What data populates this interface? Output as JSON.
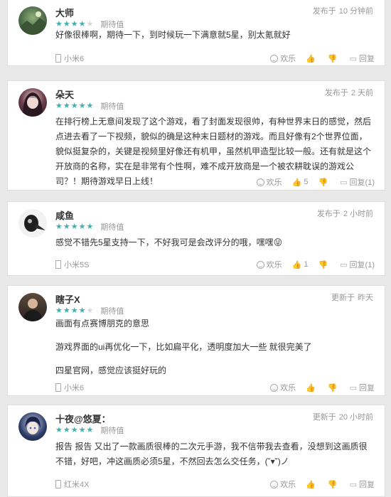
{
  "comments": [
    {
      "user": "大师",
      "rating": 4,
      "rating_label": "期待值",
      "time_label": "发布于",
      "time_value": "10 分钟前",
      "paragraphs": [
        "好像很棒啊，期待一下，到时候玩一下满意就5星，别太氪就好"
      ],
      "device": "小米6",
      "fun_label": "欢乐",
      "like_count": "",
      "dislike_count": "",
      "reply_label": "回复",
      "avatar_icon": "avatar-landscape"
    },
    {
      "user": "朵天",
      "rating": 5,
      "rating_label": "期待值",
      "time_label": "发布于",
      "time_value": "2 天前",
      "paragraphs": [
        "在排行榜上无意间发现了这个游戏，看了封面发现很帅，有种世界末日的感觉，然后点进去看了一下视频，貌似的确是这种末日题材的游戏。而且好像有2个世界位面，貌似挺复杂的，关键是视频里好像还有机甲，虽然机甲造型比较一般。还有就是这个开放商的名称，实在是非常有个性啊，难不成开放商是一个被农耕耽误的游戏公司？！期待游戏早日上线！"
      ],
      "device": "",
      "fun_label": "欢乐",
      "like_count": "5",
      "dislike_count": "",
      "reply_label": "回复(1)",
      "avatar_icon": "avatar-anime-girl"
    },
    {
      "user": "咸鱼",
      "rating": 5,
      "rating_label": "期待值",
      "time_label": "发布于",
      "time_value": "2 小时前",
      "paragraphs": [
        "感觉不错先5星支持一下，不好我可是会改评分的哦，嘿嘿😜"
      ],
      "device": "小米5S",
      "fun_label": "欢乐",
      "like_count": "1",
      "dislike_count": "",
      "reply_label": "回复(1)",
      "avatar_icon": "avatar-plague-mask"
    },
    {
      "user": "瞎子X",
      "rating": 4,
      "rating_label": "期待值",
      "time_label": "更新于",
      "time_value": "昨天",
      "paragraphs": [
        "画面有点赛博朋克的意思",
        "游戏界面的ui再优化一下，比如扁平化，透明度加大一些 就很完美了",
        "四星官网，感觉应该挺好玩的"
      ],
      "device": "小米6",
      "fun_label": "欢乐",
      "like_count": "",
      "dislike_count": "",
      "reply_label": "回复",
      "avatar_icon": "avatar-person"
    },
    {
      "user": "十夜@悠夏：",
      "rating": 5,
      "rating_label": "期待值",
      "time_label": "更新于",
      "time_value": "20 小时前",
      "paragraphs": [
        "报告 报告 又出了一款画质很棒的二次元手游，我不信带我去查看，没想到这画质很不错，好吧，冲这画质必须5星，不然回去怎么交任务，(˘▾˘)ノ"
      ],
      "device": "红米4X",
      "fun_label": "欢乐",
      "like_count": "",
      "dislike_count": "",
      "reply_label": "回复",
      "avatar_icon": "avatar-anime-boy"
    }
  ]
}
